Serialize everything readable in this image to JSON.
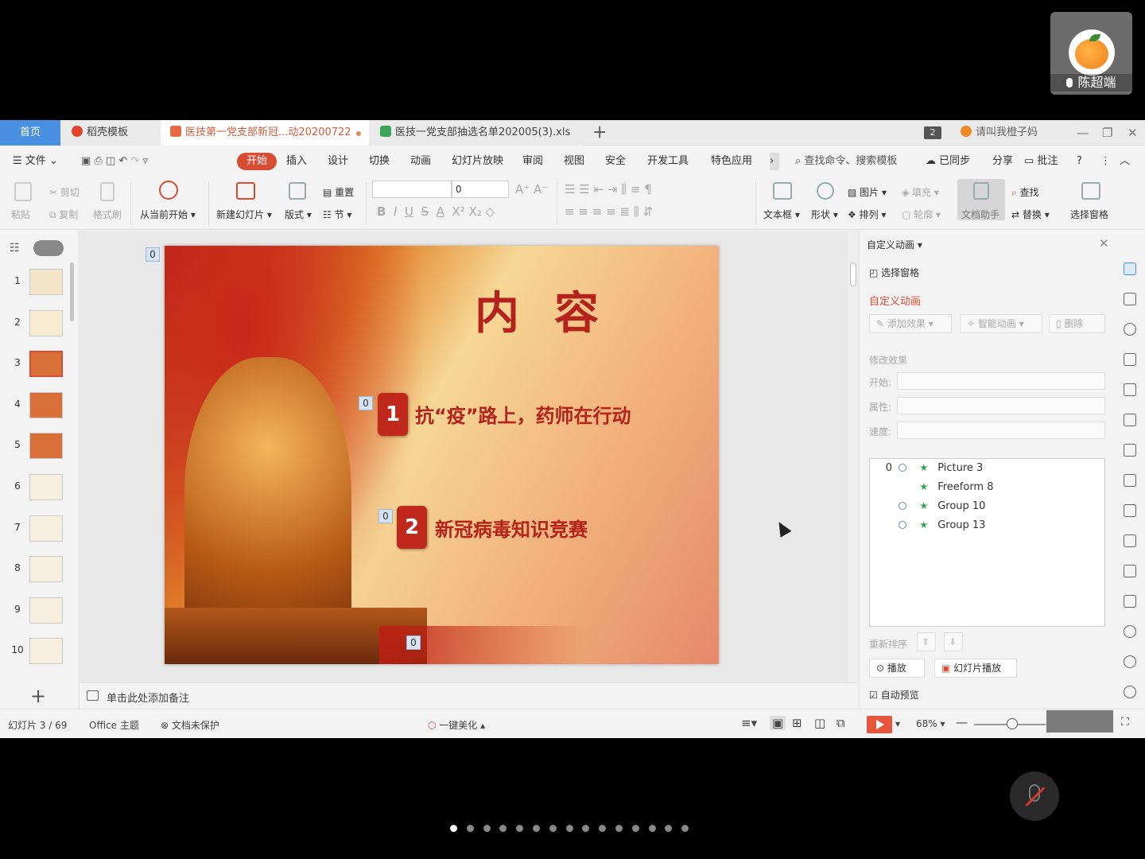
{
  "video": {
    "participant_name": "陈超端"
  },
  "tabs": {
    "home": "首页",
    "template": "稻壳模板",
    "presentation": "医技第一党支部新冠...动20200722",
    "spreadsheet": "医技一党支部抽选名单202005(3).xls",
    "new_tab": "+",
    "window_count": "2",
    "user": "请叫我橙子妈"
  },
  "menu": {
    "file": "文件",
    "start": "开始",
    "insert": "插入",
    "design": "设计",
    "transition": "切换",
    "animation": "动画",
    "slideshow": "幻灯片放映",
    "review": "审阅",
    "view": "视图",
    "security": "安全",
    "dev_tools": "开发工具",
    "special": "特色应用",
    "search": "查找命令、搜索模板",
    "synced": "已同步",
    "share": "分享",
    "comment": "批注",
    "help": "?"
  },
  "ribbon": {
    "paste": "粘贴",
    "cut": "剪切",
    "copy": "复制",
    "format_painter": "格式刷",
    "from_current": "从当前开始",
    "new_slide": "新建幻灯片",
    "layout": "版式",
    "reset": "重置",
    "section": "节",
    "font_size_value": "0",
    "text_box": "文本框",
    "shape": "形状",
    "picture": "图片",
    "arrange": "排列",
    "fill": "填充",
    "outline": "轮廓",
    "doc_helper": "文档助手",
    "find": "查找",
    "replace": "替换",
    "select_pane": "选择窗格"
  },
  "thumbnails": [
    "1",
    "2",
    "3",
    "4",
    "5",
    "6",
    "7",
    "8",
    "9",
    "10"
  ],
  "active_slide_index": 2,
  "slide": {
    "title": "内容",
    "item1_num": "1",
    "item1_text": "抗“疫”路上，药师在行动",
    "item2_num": "2",
    "item2_text": "新冠病毒知识竞赛",
    "anim_tag_title": "0",
    "anim_tag_item1": "0",
    "anim_tag_item2": "0",
    "anim_tag_bottom": "0"
  },
  "notes_placeholder": "单击此处添加备注",
  "anim_pane": {
    "header": "自定义动画",
    "select_pane": "选择窗格",
    "section_title": "自定义动画",
    "add_effect": "添加效果",
    "smart_anim": "智能动画",
    "delete": "删除",
    "modify_effect": "修改效果",
    "start_label": "开始:",
    "property_label": "属性:",
    "speed_label": "速度:",
    "effects": [
      {
        "index": "0",
        "name": "Picture 3"
      },
      {
        "index": "",
        "name": "Freeform 8"
      },
      {
        "index": "",
        "name": "Group 10"
      },
      {
        "index": "",
        "name": "Group 13"
      }
    ],
    "reorder": "重新排序",
    "play": "播放",
    "slideshow": "幻灯片播放",
    "auto_preview": "自动预览"
  },
  "status": {
    "slide_counter": "幻灯片 3 / 69",
    "theme": "Office 主题",
    "protection": "文档未保护",
    "beautify": "一键美化",
    "zoom": "68%"
  },
  "page_dots": {
    "count": 15,
    "active": 0
  },
  "colors": {
    "accent": "#d94c34",
    "home_tab": "#4a90e2",
    "slide_red": "#b3221b"
  }
}
